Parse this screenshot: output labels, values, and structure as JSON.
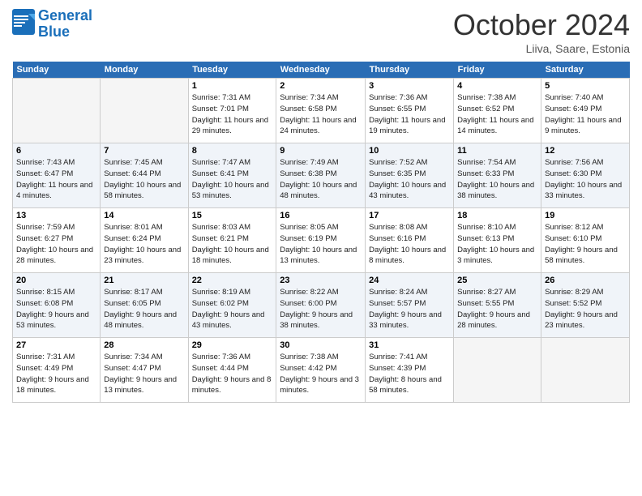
{
  "header": {
    "logo_line1": "General",
    "logo_line2": "Blue",
    "month": "October 2024",
    "location": "Liiva, Saare, Estonia"
  },
  "weekdays": [
    "Sunday",
    "Monday",
    "Tuesday",
    "Wednesday",
    "Thursday",
    "Friday",
    "Saturday"
  ],
  "weeks": [
    [
      {
        "day": "",
        "sunrise": "",
        "sunset": "",
        "daylight": ""
      },
      {
        "day": "",
        "sunrise": "",
        "sunset": "",
        "daylight": ""
      },
      {
        "day": "1",
        "sunrise": "Sunrise: 7:31 AM",
        "sunset": "Sunset: 7:01 PM",
        "daylight": "Daylight: 11 hours and 29 minutes."
      },
      {
        "day": "2",
        "sunrise": "Sunrise: 7:34 AM",
        "sunset": "Sunset: 6:58 PM",
        "daylight": "Daylight: 11 hours and 24 minutes."
      },
      {
        "day": "3",
        "sunrise": "Sunrise: 7:36 AM",
        "sunset": "Sunset: 6:55 PM",
        "daylight": "Daylight: 11 hours and 19 minutes."
      },
      {
        "day": "4",
        "sunrise": "Sunrise: 7:38 AM",
        "sunset": "Sunset: 6:52 PM",
        "daylight": "Daylight: 11 hours and 14 minutes."
      },
      {
        "day": "5",
        "sunrise": "Sunrise: 7:40 AM",
        "sunset": "Sunset: 6:49 PM",
        "daylight": "Daylight: 11 hours and 9 minutes."
      }
    ],
    [
      {
        "day": "6",
        "sunrise": "Sunrise: 7:43 AM",
        "sunset": "Sunset: 6:47 PM",
        "daylight": "Daylight: 11 hours and 4 minutes."
      },
      {
        "day": "7",
        "sunrise": "Sunrise: 7:45 AM",
        "sunset": "Sunset: 6:44 PM",
        "daylight": "Daylight: 10 hours and 58 minutes."
      },
      {
        "day": "8",
        "sunrise": "Sunrise: 7:47 AM",
        "sunset": "Sunset: 6:41 PM",
        "daylight": "Daylight: 10 hours and 53 minutes."
      },
      {
        "day": "9",
        "sunrise": "Sunrise: 7:49 AM",
        "sunset": "Sunset: 6:38 PM",
        "daylight": "Daylight: 10 hours and 48 minutes."
      },
      {
        "day": "10",
        "sunrise": "Sunrise: 7:52 AM",
        "sunset": "Sunset: 6:35 PM",
        "daylight": "Daylight: 10 hours and 43 minutes."
      },
      {
        "day": "11",
        "sunrise": "Sunrise: 7:54 AM",
        "sunset": "Sunset: 6:33 PM",
        "daylight": "Daylight: 10 hours and 38 minutes."
      },
      {
        "day": "12",
        "sunrise": "Sunrise: 7:56 AM",
        "sunset": "Sunset: 6:30 PM",
        "daylight": "Daylight: 10 hours and 33 minutes."
      }
    ],
    [
      {
        "day": "13",
        "sunrise": "Sunrise: 7:59 AM",
        "sunset": "Sunset: 6:27 PM",
        "daylight": "Daylight: 10 hours and 28 minutes."
      },
      {
        "day": "14",
        "sunrise": "Sunrise: 8:01 AM",
        "sunset": "Sunset: 6:24 PM",
        "daylight": "Daylight: 10 hours and 23 minutes."
      },
      {
        "day": "15",
        "sunrise": "Sunrise: 8:03 AM",
        "sunset": "Sunset: 6:21 PM",
        "daylight": "Daylight: 10 hours and 18 minutes."
      },
      {
        "day": "16",
        "sunrise": "Sunrise: 8:05 AM",
        "sunset": "Sunset: 6:19 PM",
        "daylight": "Daylight: 10 hours and 13 minutes."
      },
      {
        "day": "17",
        "sunrise": "Sunrise: 8:08 AM",
        "sunset": "Sunset: 6:16 PM",
        "daylight": "Daylight: 10 hours and 8 minutes."
      },
      {
        "day": "18",
        "sunrise": "Sunrise: 8:10 AM",
        "sunset": "Sunset: 6:13 PM",
        "daylight": "Daylight: 10 hours and 3 minutes."
      },
      {
        "day": "19",
        "sunrise": "Sunrise: 8:12 AM",
        "sunset": "Sunset: 6:10 PM",
        "daylight": "Daylight: 9 hours and 58 minutes."
      }
    ],
    [
      {
        "day": "20",
        "sunrise": "Sunrise: 8:15 AM",
        "sunset": "Sunset: 6:08 PM",
        "daylight": "Daylight: 9 hours and 53 minutes."
      },
      {
        "day": "21",
        "sunrise": "Sunrise: 8:17 AM",
        "sunset": "Sunset: 6:05 PM",
        "daylight": "Daylight: 9 hours and 48 minutes."
      },
      {
        "day": "22",
        "sunrise": "Sunrise: 8:19 AM",
        "sunset": "Sunset: 6:02 PM",
        "daylight": "Daylight: 9 hours and 43 minutes."
      },
      {
        "day": "23",
        "sunrise": "Sunrise: 8:22 AM",
        "sunset": "Sunset: 6:00 PM",
        "daylight": "Daylight: 9 hours and 38 minutes."
      },
      {
        "day": "24",
        "sunrise": "Sunrise: 8:24 AM",
        "sunset": "Sunset: 5:57 PM",
        "daylight": "Daylight: 9 hours and 33 minutes."
      },
      {
        "day": "25",
        "sunrise": "Sunrise: 8:27 AM",
        "sunset": "Sunset: 5:55 PM",
        "daylight": "Daylight: 9 hours and 28 minutes."
      },
      {
        "day": "26",
        "sunrise": "Sunrise: 8:29 AM",
        "sunset": "Sunset: 5:52 PM",
        "daylight": "Daylight: 9 hours and 23 minutes."
      }
    ],
    [
      {
        "day": "27",
        "sunrise": "Sunrise: 7:31 AM",
        "sunset": "Sunset: 4:49 PM",
        "daylight": "Daylight: 9 hours and 18 minutes."
      },
      {
        "day": "28",
        "sunrise": "Sunrise: 7:34 AM",
        "sunset": "Sunset: 4:47 PM",
        "daylight": "Daylight: 9 hours and 13 minutes."
      },
      {
        "day": "29",
        "sunrise": "Sunrise: 7:36 AM",
        "sunset": "Sunset: 4:44 PM",
        "daylight": "Daylight: 9 hours and 8 minutes."
      },
      {
        "day": "30",
        "sunrise": "Sunrise: 7:38 AM",
        "sunset": "Sunset: 4:42 PM",
        "daylight": "Daylight: 9 hours and 3 minutes."
      },
      {
        "day": "31",
        "sunrise": "Sunrise: 7:41 AM",
        "sunset": "Sunset: 4:39 PM",
        "daylight": "Daylight: 8 hours and 58 minutes."
      },
      {
        "day": "",
        "sunrise": "",
        "sunset": "",
        "daylight": ""
      },
      {
        "day": "",
        "sunrise": "",
        "sunset": "",
        "daylight": ""
      }
    ]
  ]
}
